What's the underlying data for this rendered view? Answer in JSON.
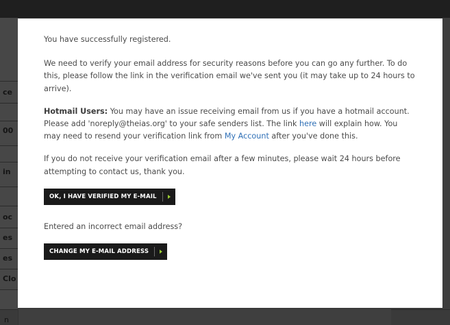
{
  "background": {
    "fragments": [
      "ce",
      "00",
      "in",
      "oc",
      "es",
      "es",
      "Clo"
    ],
    "bottom_fragment": "n"
  },
  "modal": {
    "p1": "You have successfully registered.",
    "p2": "We need to verify your email address for security reasons before you can go any further. To do this, please follow the link in the verification email we've sent you (it may take up to 24 hours to arrive).",
    "p3": {
      "label": "Hotmail Users:",
      "text_a": " You may have an issue receiving email from us if you have a hotmail account. Please add 'noreply@theias.org' to your safe senders list. The link ",
      "link_here": "here",
      "text_b": " will explain how. You may need to resend your verification link from ",
      "link_account": "My Account",
      "text_c": " after you've done this."
    },
    "p4": "If you do not receive your verification email after a few minutes, please wait 24 hours before attempting to contact us, thank you.",
    "verified_button": "OK, I HAVE VERIFIED MY E-MAIL",
    "incorrect_prompt": "Entered an incorrect email address?",
    "change_button": "CHANGE MY E-MAIL ADDRESS",
    "accent_color": "#9acd32",
    "link_color": "#2e6fb6"
  }
}
